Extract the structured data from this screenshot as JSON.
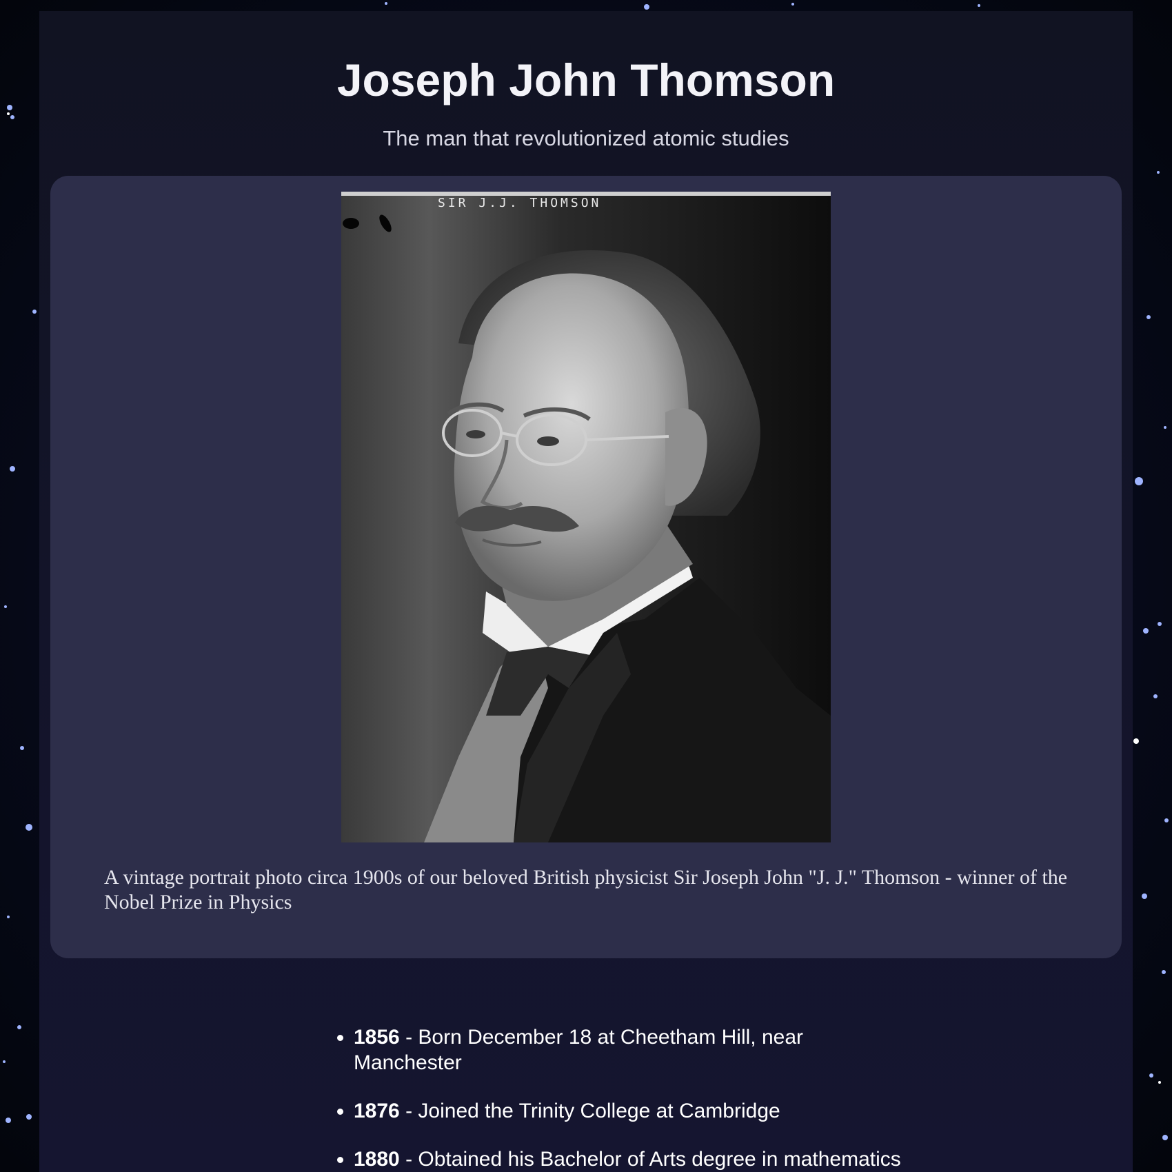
{
  "page": {
    "title": "Joseph John Thomson",
    "subtitle": "The man that revolutionized atomic studies"
  },
  "figure": {
    "image_inscription": "SIR J.J. THOMSON",
    "caption": "A vintage portrait photo circa 1900s of our beloved British physicist Sir Joseph John \"J. J.\" Thomson - winner of the Nobel Prize in Physics"
  },
  "timeline": [
    {
      "year": "1856",
      "text": " - Born December 18 at Cheetham Hill, near Manchester"
    },
    {
      "year": "1876",
      "text": " - Joined the Trinity College at Cambridge"
    },
    {
      "year": "1880",
      "text": " - Obtained his Bachelor of Arts degree in mathematics"
    }
  ],
  "colors": {
    "page_background": "#060812",
    "main_background": "#111322",
    "image_panel": "#2d2e4a",
    "text": "#ffffff"
  }
}
